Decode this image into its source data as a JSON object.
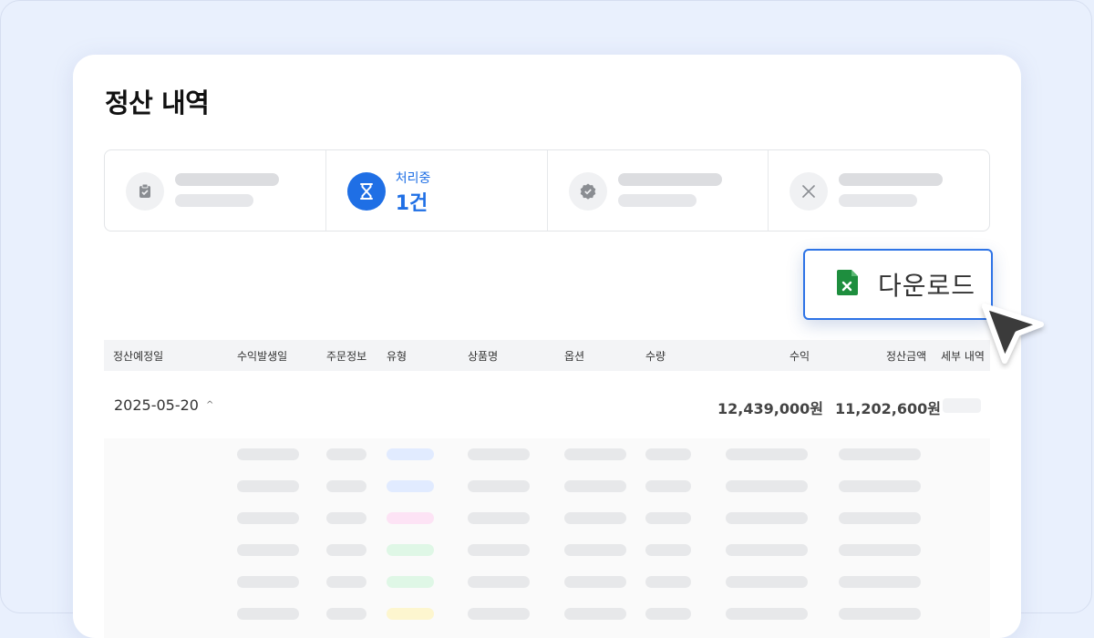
{
  "page": {
    "title": "정산 내역"
  },
  "summary": {
    "processing": {
      "label": "처리중",
      "value": "1건"
    }
  },
  "download": {
    "label": "다운로드",
    "icon": "excel-file-icon"
  },
  "table": {
    "headers": [
      "정산예정일",
      "수익발생일",
      "주문정보",
      "유형",
      "상품명",
      "옵션",
      "수량",
      "수익",
      "정산금액",
      "세부 내역"
    ],
    "group": {
      "date": "2025-05-20",
      "revenue": "12,439,000원",
      "settlement": "11,202,600원"
    }
  },
  "colors": {
    "accent": "#1f6fe5",
    "excel_green": "#1e8e3e",
    "type_pill_colors": [
      "#e1ebff",
      "#e1ebff",
      "#fde3f5",
      "#dff7e6",
      "#dff7e6",
      "#fdf6cf"
    ]
  }
}
